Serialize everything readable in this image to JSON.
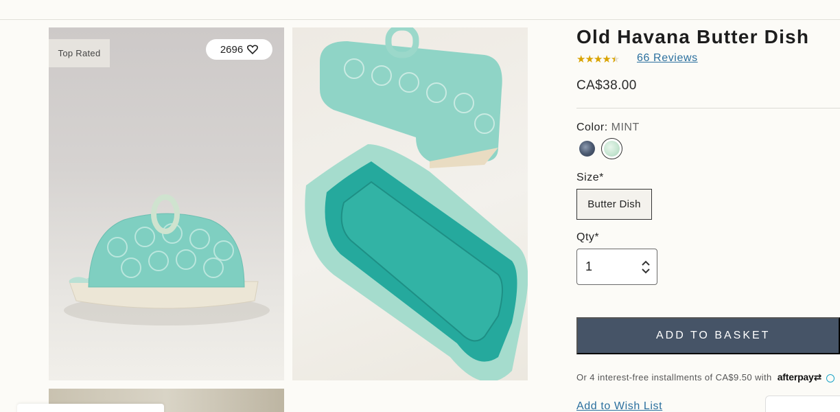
{
  "gallery": {
    "badge": "Top Rated",
    "favorite_count": "2696"
  },
  "product": {
    "title": "Old Havana Butter Dish",
    "rating": 4.5,
    "reviews_link": "66 Reviews",
    "price": "CA$38.00",
    "color_label": "Color:",
    "color_value": "MINT",
    "swatches": [
      "navy",
      "mint"
    ],
    "selected_swatch": "mint",
    "size_label": "Size*",
    "size_option": "Butter Dish",
    "qty_label": "Qty*",
    "qty_value": "1",
    "add_button": "ADD TO BASKET",
    "afterpay_text": "Or 4 interest-free installments of CA$9.50 with",
    "afterpay_brand": "afterpay",
    "wishlist_link": "Add to Wish List"
  },
  "colors": {
    "accent_button": "#465467",
    "link": "#2a6f9e",
    "star": "#d9a300",
    "background": "#fcfbf7"
  }
}
